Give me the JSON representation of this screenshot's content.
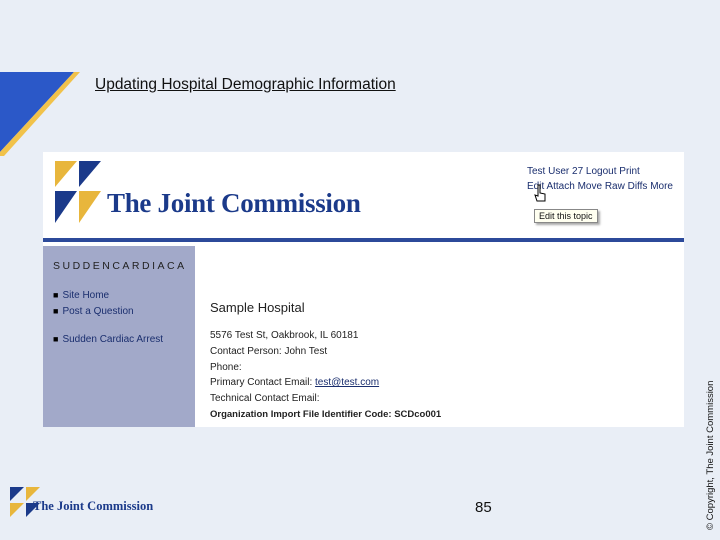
{
  "slide": {
    "title": "Updating Hospital Demographic Information",
    "copyright": "© Copyright, The Joint Commission",
    "page_number": "85",
    "footer_brand": "The Joint Commission"
  },
  "screenshot": {
    "brand": "The Joint Commission",
    "user_links": "Test User 27  Logout  Print",
    "page_actions": "Edit  Attach  Move  Raw  Diffs  More",
    "tooltip": "Edit this topic",
    "sidebar": {
      "heading": "SUDDENCARDIACA",
      "items": [
        "Site Home",
        "Post a Question",
        "Sudden Cardiac Arrest"
      ]
    },
    "hospital": {
      "name": "Sample Hospital",
      "address": "5576 Test St, Oakbrook, IL 60181",
      "contact_person": "Contact Person: John Test",
      "phone": "Phone:",
      "primary_email_label": "Primary Contact Email:",
      "primary_email": "test@test.com",
      "technical_email": "Technical Contact Email:",
      "org_id": "Organization Import File Identifier Code: SCDco001"
    }
  },
  "colors": {
    "background": "#e9eef6",
    "brand_blue": "#1b3a8a",
    "logo_gold": "#e8b63c",
    "sidebar": "#a2a9c9"
  },
  "icons": [
    "tjc-logo-icon",
    "hand-cursor-icon"
  ]
}
